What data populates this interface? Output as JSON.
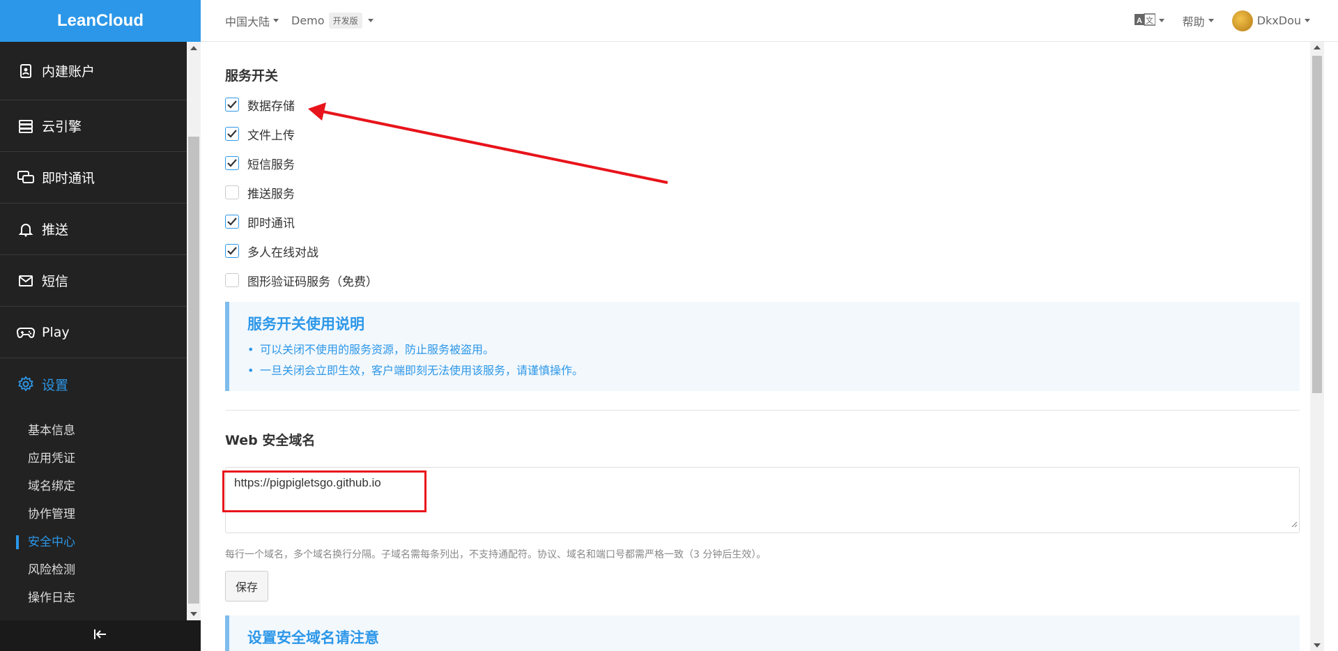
{
  "app": {
    "logo": "LeanCloud",
    "accent": "#2c97e8"
  },
  "topbar": {
    "region": "中国大陆",
    "app_name": "Demo",
    "plan_badge": "开发版",
    "help": "帮助",
    "user": "DkxDou"
  },
  "sidebar": {
    "items": [
      {
        "label": "内建账户",
        "icon": "id-card-icon"
      },
      {
        "label": "云引擎",
        "icon": "server-icon"
      },
      {
        "label": "即时通讯",
        "icon": "chat-icon"
      },
      {
        "label": "推送",
        "icon": "bell-icon"
      },
      {
        "label": "短信",
        "icon": "mail-icon"
      },
      {
        "label": "Play",
        "icon": "gamepad-icon"
      },
      {
        "label": "设置",
        "icon": "gear-icon",
        "active": true
      }
    ],
    "sub_items": [
      "基本信息",
      "应用凭证",
      "域名绑定",
      "协作管理",
      "安全中心",
      "风险检测",
      "操作日志"
    ],
    "active_sub": "安全中心"
  },
  "services": {
    "title": "服务开关",
    "items": [
      {
        "label": "数据存储",
        "checked": true
      },
      {
        "label": "文件上传",
        "checked": true
      },
      {
        "label": "短信服务",
        "checked": true
      },
      {
        "label": "推送服务",
        "checked": false
      },
      {
        "label": "即时通讯",
        "checked": true
      },
      {
        "label": "多人在线对战",
        "checked": true
      },
      {
        "label": "图形验证码服务（免费）",
        "checked": false
      }
    ]
  },
  "services_note": {
    "title": "服务开关使用说明",
    "bullets": [
      "可以关闭不使用的服务资源，防止服务被盗用。",
      "一旦关闭会立即生效，客户端即刻无法使用该服务，请谨慎操作。"
    ]
  },
  "web_domains": {
    "title": "Web 安全域名",
    "value": "https://pigpigletsgo.github.io",
    "help": "每行一个域名，多个域名换行分隔。子域名需每条列出，不支持通配符。协议、域名和端口号都需严格一致（3 分钟后生效）。",
    "save_label": "保存"
  },
  "domain_note": {
    "title": "设置安全域名请注意"
  },
  "annotations": {
    "color": "#e8141b"
  }
}
